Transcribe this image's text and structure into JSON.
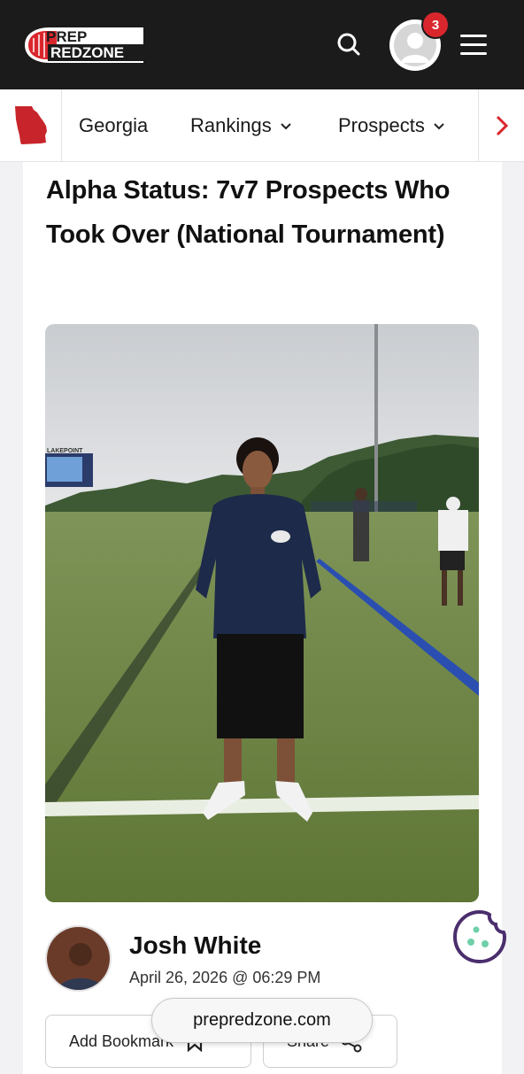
{
  "header": {
    "logo_line1": "PREP",
    "logo_line2": "REDZONE",
    "notification_count": "3",
    "brand_color": "#d9262d"
  },
  "nav": {
    "items": [
      {
        "label": "Georgia"
      },
      {
        "label": "Rankings"
      },
      {
        "label": "Prospects"
      }
    ],
    "state_icon": "georgia-map-icon"
  },
  "article": {
    "title": "Alpha Status: 7v7 Prospects Who Took Over (National Tournament)",
    "hero_sign_text": "LAKEPOINT",
    "author": "Josh White",
    "date": "April 26, 2026 @ 06:29 PM"
  },
  "actions": {
    "bookmark_label": "Add Bookmark",
    "share_label": "Share"
  },
  "browser": {
    "url": "prepredzone.com"
  }
}
